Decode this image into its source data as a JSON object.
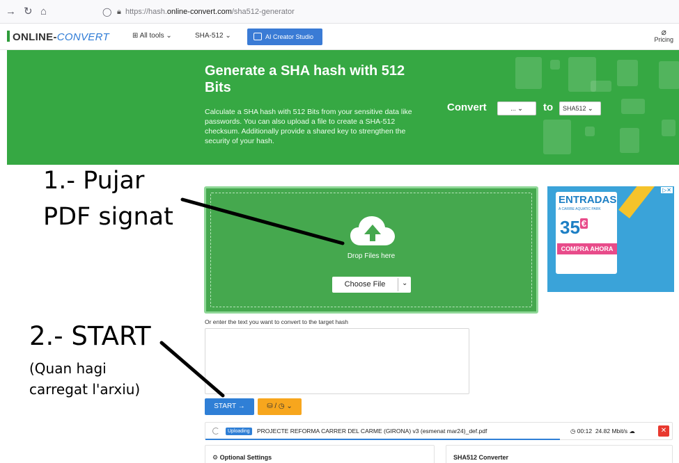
{
  "browser": {
    "url_prefix": "https://hash.",
    "url_domain": "online-convert.com",
    "url_path": "/sha512-generator"
  },
  "header": {
    "logo_online": "ONLINE-",
    "logo_convert": "CONVERT",
    "all_tools": "All tools",
    "sha512": "SHA-512",
    "ai_creator": "AI Creator Studio",
    "pricing": "Pricing"
  },
  "hero": {
    "title": "Generate a SHA hash with 512 Bits",
    "description": "Calculate a SHA hash with 512 Bits from your sensitive data like passwords. You can also upload a file to create a SHA-512 checksum. Additionally provide a shared key to strengthen the security of your hash.",
    "convert_label": "Convert",
    "from_value": "...",
    "to_label": "to",
    "to_value": "SHA512"
  },
  "annotations": {
    "step1_line1": "1.- Pujar",
    "step1_line2": "PDF signat",
    "step2_title": "2.- START",
    "step2_note_line1": "(Quan hagi",
    "step2_note_line2": "carregat l'arxiu)"
  },
  "dropzone": {
    "drop_text": "Drop Files here",
    "choose_file": "Choose File"
  },
  "ad": {
    "title": "ENTRADAS",
    "subtitle": "A CARIBE AQUATIC PARK",
    "price": "35",
    "currency": "€",
    "cta": "COMPRA AHORA"
  },
  "text_input": {
    "label": "Or enter the text you want to convert to the target hash",
    "value": ""
  },
  "actions": {
    "start": "START →",
    "options": "⛁ / ◷"
  },
  "upload": {
    "status": "Uploading",
    "filename": "PROJECTE REFORMA CARRER DEL CARME (GIRONA) v3 (esmenat mar24)_def.pdf",
    "time": "00:12",
    "speed": "24.82 Mbit/s",
    "progress": 0.76
  },
  "cards": {
    "optional_settings": "Optional Settings",
    "converter": "SHA512 Converter"
  },
  "colors": {
    "hero_green": "#36a843",
    "dropzone_green": "#45a84e",
    "primary_blue": "#2f7fd6",
    "options_orange": "#f7a61d",
    "cancel_red": "#e8392f"
  }
}
